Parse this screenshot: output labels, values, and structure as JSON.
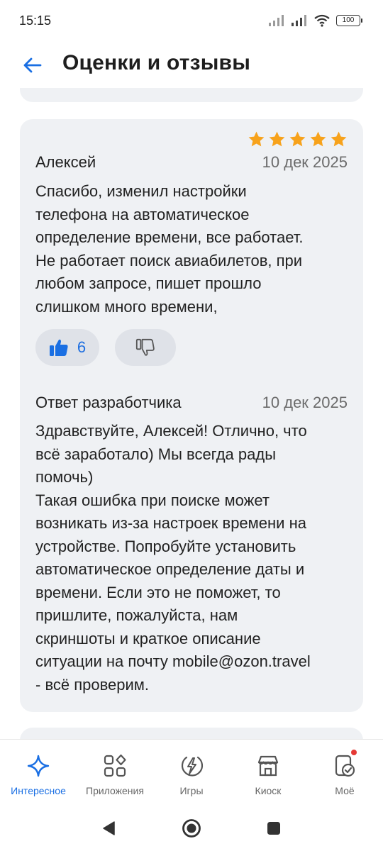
{
  "status_bar": {
    "time": "15:15",
    "battery": "100"
  },
  "header": {
    "title": "Оценки и отзывы"
  },
  "review": {
    "rating": 5,
    "author": "Алексей",
    "date": "10 дек 2025",
    "text": "Спасибо, изменил настройки\nтелефона на автоматическое\nопределение  времени, все работает.\nНе работает поиск авиабилетов, при\nлюбом запросе, пишет прошло\nслишком много времени,",
    "likes": "6"
  },
  "developer_reply": {
    "label": "Ответ разработчика",
    "date": "10 дек 2025",
    "text": "Здравствуйте, Алексей! Отлично, что\nвсё заработало) Мы всегда рады\nпомочь)\nТакая ошибка при поиске может\nвозникать из-за настроек времени на\nустройстве. Попробуйте установить\nавтоматическое определение даты и\nвремени. Если это не поможет, то\nпришлите, пожалуйста, нам\nскриншоты и краткое описание\nситуации на почту mobile@ozon.travel\n- всё проверим."
  },
  "bottom_nav": {
    "items": [
      {
        "label": "Интересное",
        "icon": "sparkle-icon",
        "active": true
      },
      {
        "label": "Приложения",
        "icon": "apps-grid-icon",
        "active": false
      },
      {
        "label": "Игры",
        "icon": "games-icon",
        "active": false
      },
      {
        "label": "Киоск",
        "icon": "kiosk-icon",
        "active": false
      },
      {
        "label": "Моё",
        "icon": "my-apps-icon",
        "active": false
      }
    ]
  },
  "colors": {
    "accent": "#1a6fe3",
    "star": "#f7a21b",
    "card_bg": "#eff1f4",
    "notification_dot": "#e53935"
  }
}
